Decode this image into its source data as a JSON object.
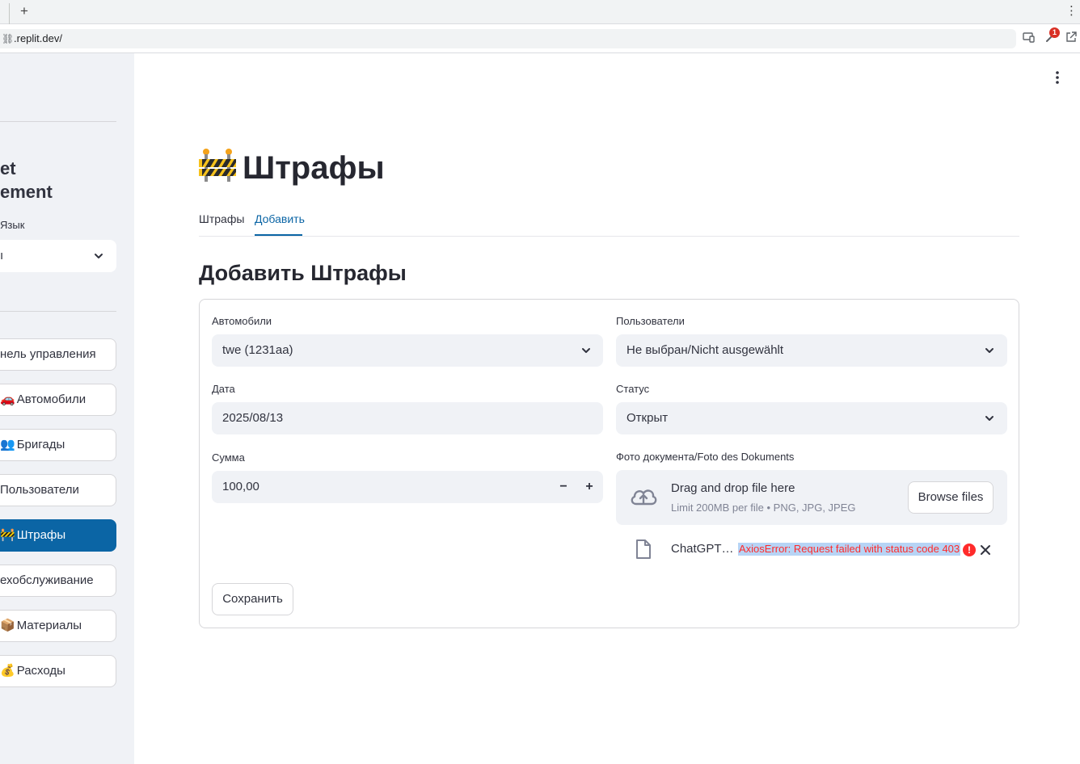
{
  "browser": {
    "new_tab": "+",
    "url": ".replit.dev/",
    "notification_count": "1"
  },
  "sidebar": {
    "title_line1": "et",
    "title_line2": "ement",
    "language_label": "Язык",
    "language_value": "ı",
    "nav": [
      {
        "icon": "",
        "label": "нель управления",
        "active": false
      },
      {
        "icon": "🚗",
        "label": "Автомобили",
        "active": false
      },
      {
        "icon": "👥",
        "label": "Бригады",
        "active": false
      },
      {
        "icon": "",
        "label": "Пользователи",
        "active": false
      },
      {
        "icon": "🚧",
        "label": "Штрафы",
        "active": true
      },
      {
        "icon": "",
        "label": "ехобслуживание",
        "active": false
      },
      {
        "icon": "📦",
        "label": "Материалы",
        "active": false
      },
      {
        "icon": "💰",
        "label": "Расходы",
        "active": false
      }
    ]
  },
  "main": {
    "title": "Штрафы",
    "tabs": [
      {
        "label": "Штрафы",
        "active": false
      },
      {
        "label": "Добавить",
        "active": true
      }
    ],
    "section_title": "Добавить Штрафы",
    "form": {
      "cars_label": "Автомобили",
      "cars_value": "twe (1231aa)",
      "users_label": "Пользователи",
      "users_value": "Не выбран/Nicht ausgewählt",
      "date_label": "Дата",
      "date_value": "2025/08/13",
      "status_label": "Статус",
      "status_value": "Открыт",
      "amount_label": "Сумма",
      "amount_value": "100,00",
      "minus": "−",
      "plus": "+",
      "photo_label": "Фото документа/Foto des Dokuments",
      "upload_main": "Drag and drop file here",
      "upload_sub": "Limit 200MB per file • PNG, JPG, JPEG",
      "browse_label": "Browse files",
      "file_name": "ChatGPT…",
      "file_error": "AxiosError: Request failed with status code 403",
      "error_mark": "!",
      "save_label": "Сохранить"
    }
  },
  "colors": {
    "accent": "#0b65a5",
    "error": "#ff2b2b",
    "input_bg": "#f0f2f6"
  }
}
